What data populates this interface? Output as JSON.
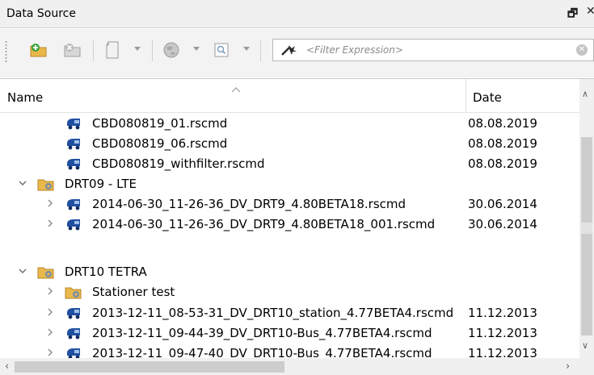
{
  "panel": {
    "title": "Data Source",
    "float_glyph": "🗗",
    "close_glyph": "✕"
  },
  "toolbar": {
    "filter_placeholder": "<Filter Expression>",
    "icons": [
      "add-folder-icon",
      "remove-folder-icon",
      "document-icon",
      "globe-icon",
      "zoom-frame-icon",
      "filter-wand-icon",
      "clear-icon"
    ]
  },
  "columns": {
    "name": "Name",
    "date": "Date"
  },
  "rows": [
    {
      "name": "CBD080819_01.rscmd",
      "date": "08.08.2019",
      "type": "file"
    },
    {
      "name": "CBD080819_06.rscmd",
      "date": "08.08.2019",
      "type": "file"
    },
    {
      "name": "CBD080819_withfilter.rscmd",
      "date": "08.08.2019",
      "type": "file"
    },
    {
      "name": "DRT09 - LTE",
      "date": "",
      "type": "folder",
      "expanded": true
    },
    {
      "name": "2014-06-30_11-26-36_DV_DRT9_4.80BETA18.rscmd",
      "date": "30.06.2014",
      "type": "file"
    },
    {
      "name": "2014-06-30_11-26-36_DV_DRT9_4.80BETA18_001.rscmd",
      "date": "30.06.2014",
      "type": "file"
    },
    {
      "name": "DRT10 TETRA",
      "date": "",
      "type": "folder",
      "expanded": true
    },
    {
      "name": "Stationer test",
      "date": "",
      "type": "folder",
      "expanded": false
    },
    {
      "name": "2013-12-11_08-53-31_DV_DRT10_station_4.77BETA4.rscmd",
      "date": "11.12.2013",
      "type": "file"
    },
    {
      "name": "2013-12-11_09-44-39_DV_DRT10-Bus_4.77BETA4.rscmd",
      "date": "11.12.2013",
      "type": "file"
    },
    {
      "name": "2013-12-11_09-47-40_DV_DRT10-Bus_4.77BETA4.rscmd",
      "date": "11.12.2013",
      "type": "file"
    }
  ],
  "glyphs": {
    "expanded": "⌄",
    "collapsed": "›",
    "up": "∧",
    "down": "∨",
    "left": "‹",
    "right": "›",
    "sort": "⌃",
    "clear": "✕"
  },
  "colors": {
    "folder": "#e8b84a",
    "camera_blue": "#1f4fa0",
    "accent_green": "#3aa43a"
  }
}
